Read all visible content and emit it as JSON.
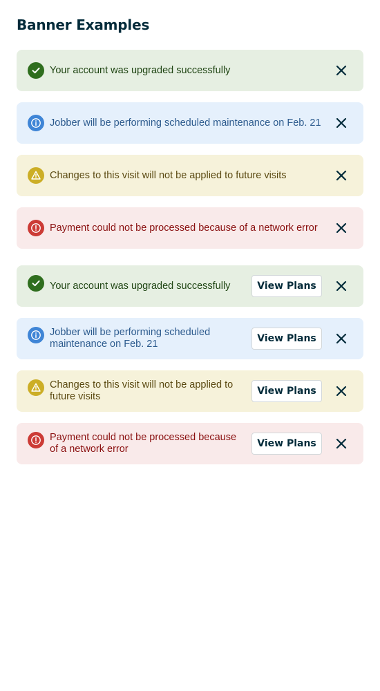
{
  "page": {
    "title": "Banner Examples"
  },
  "colors": {
    "title": "#032b3a",
    "success_bg": "#e6efe2",
    "success_text": "#1f4513",
    "success_icon": "#2f6e1e",
    "info_bg": "#e5f0fc",
    "info_text": "#2d5b8e",
    "info_icon": "#3f85d6",
    "warning_bg": "#f6f2da",
    "warning_text": "#5b4a12",
    "warning_icon": "#ccae26",
    "error_bg": "#f9eaea",
    "error_text": "#8a1010",
    "error_icon": "#cc3b36"
  },
  "banners": [
    {
      "type": "success",
      "icon": "checkmark-icon",
      "message": "Your account was upgraded successfully"
    },
    {
      "type": "info",
      "icon": "info-icon",
      "message": "Jobber will be performing scheduled maintenance on Feb. 21"
    },
    {
      "type": "warning",
      "icon": "warning-icon",
      "message": "Changes to this visit will not be applied to future visits"
    },
    {
      "type": "error",
      "icon": "alert-icon",
      "message": "Payment could not be processed because of a network error"
    }
  ],
  "action_banners": [
    {
      "type": "success",
      "icon": "checkmark-icon",
      "message": "Your account was upgraded successfully",
      "action_label": "View Plans"
    },
    {
      "type": "info",
      "icon": "info-icon",
      "message": "Jobber will be performing scheduled maintenance on Feb. 21",
      "action_label": "View Plans"
    },
    {
      "type": "warning",
      "icon": "warning-icon",
      "message": "Changes to this visit will not be applied to future visits",
      "action_label": "View Plans"
    },
    {
      "type": "error",
      "icon": "alert-icon",
      "message": "Payment could not be processed because of a network error",
      "action_label": "View Plans"
    }
  ]
}
